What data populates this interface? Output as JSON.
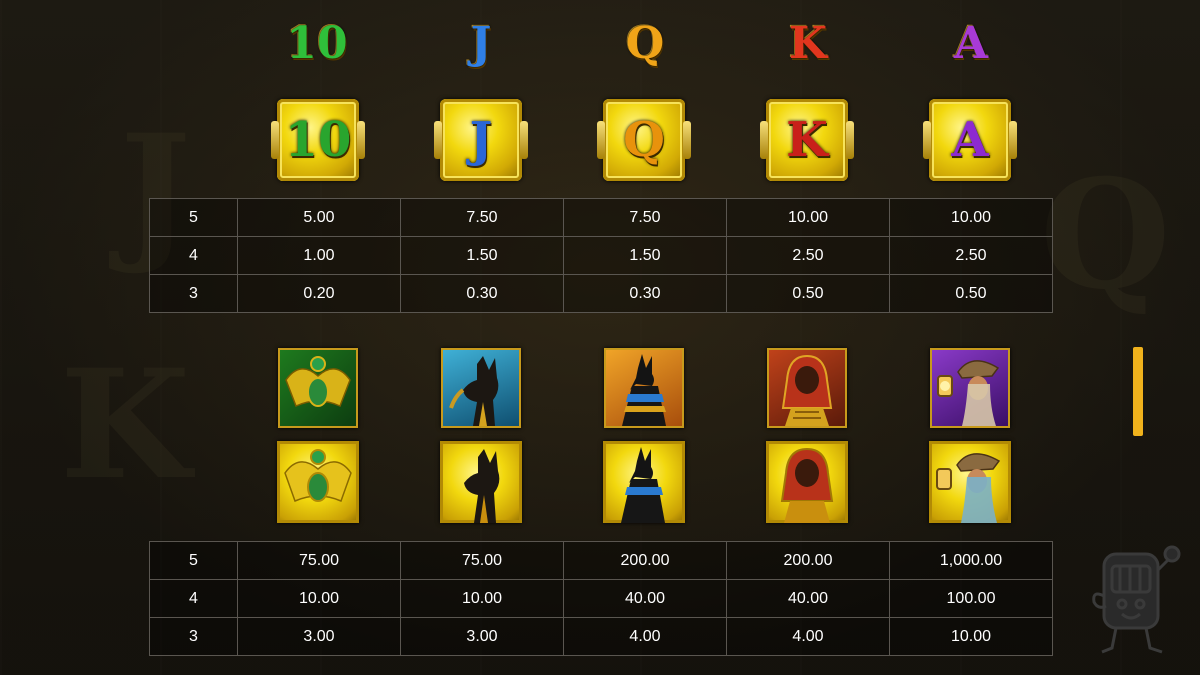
{
  "header_symbols": [
    {
      "label": "10",
      "color": "#2fbf3a"
    },
    {
      "label": "J",
      "color": "#2f7fe6"
    },
    {
      "label": "Q",
      "color": "#f0a418"
    },
    {
      "label": "K",
      "color": "#e2361e"
    },
    {
      "label": "A",
      "color": "#a83ad6"
    }
  ],
  "tile_symbols": [
    {
      "label": "10",
      "color": "#29a52e"
    },
    {
      "label": "J",
      "color": "#2a66d8"
    },
    {
      "label": "Q",
      "color": "#e8920c"
    },
    {
      "label": "K",
      "color": "#c9201a"
    },
    {
      "label": "A",
      "color": "#8d2ad0"
    }
  ],
  "high_symbols": [
    {
      "icon": "scarab-icon"
    },
    {
      "icon": "bastet-icon"
    },
    {
      "icon": "anubis-icon"
    },
    {
      "icon": "pharaoh-icon"
    },
    {
      "icon": "explorer-icon"
    }
  ],
  "low_table": {
    "rows": [
      {
        "count": "5",
        "values": [
          "5.00",
          "7.50",
          "7.50",
          "10.00",
          "10.00"
        ]
      },
      {
        "count": "4",
        "values": [
          "1.00",
          "1.50",
          "1.50",
          "2.50",
          "2.50"
        ]
      },
      {
        "count": "3",
        "values": [
          "0.20",
          "0.30",
          "0.30",
          "0.50",
          "0.50"
        ]
      }
    ]
  },
  "high_table": {
    "rows": [
      {
        "count": "5",
        "values": [
          "75.00",
          "75.00",
          "200.00",
          "200.00",
          "1,000.00"
        ]
      },
      {
        "count": "4",
        "values": [
          "10.00",
          "10.00",
          "40.00",
          "40.00",
          "100.00"
        ]
      },
      {
        "count": "3",
        "values": [
          "3.00",
          "3.00",
          "4.00",
          "4.00",
          "10.00"
        ]
      }
    ]
  },
  "colors": {
    "accent": "#f0b21c",
    "gold": "#f2d80e",
    "table_border": "#5a5650"
  }
}
